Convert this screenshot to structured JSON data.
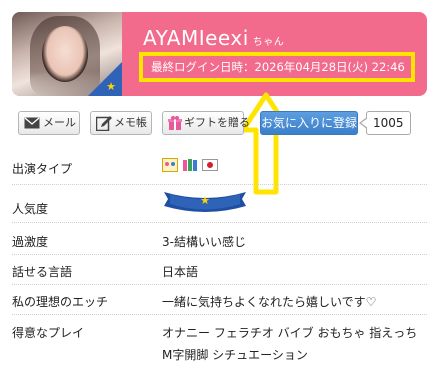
{
  "profile": {
    "name": "AYAMIeexi",
    "name_suffix": "ちゃん",
    "last_login": "最終ログイン日時：2026年04月28日(火) 22:46"
  },
  "actions": {
    "mail_label": "メール",
    "memo_label": "メモ帳",
    "gift_label": "ギフトを贈る",
    "favorite_label": "お気に入りに登録",
    "favorite_count": "1005"
  },
  "details": [
    {
      "label": "出演タイプ",
      "value": ""
    },
    {
      "label": "人気度",
      "value": ""
    },
    {
      "label": "過激度",
      "value": "3-結構いい感じ"
    },
    {
      "label": "話せる言語",
      "value": "日本語"
    },
    {
      "label": "私の理想のエッチ",
      "value": "一緒に気持ちよくなれたら嬉しいです♡"
    },
    {
      "label": "得意なプレイ",
      "value": "オナニー フェラチオ バイブ おもちゃ 指えっち M字開脚 シチュエーション"
    }
  ],
  "colors": {
    "header_bg": "#f26b8c",
    "highlight": "#ffe400",
    "favorite_btn": "#3a7fcb",
    "ribbon": "#2e63b8"
  },
  "icons": [
    "mail-icon",
    "memo-icon",
    "gift-icon",
    "star-icon",
    "flag-jp-icon",
    "type-icon"
  ]
}
